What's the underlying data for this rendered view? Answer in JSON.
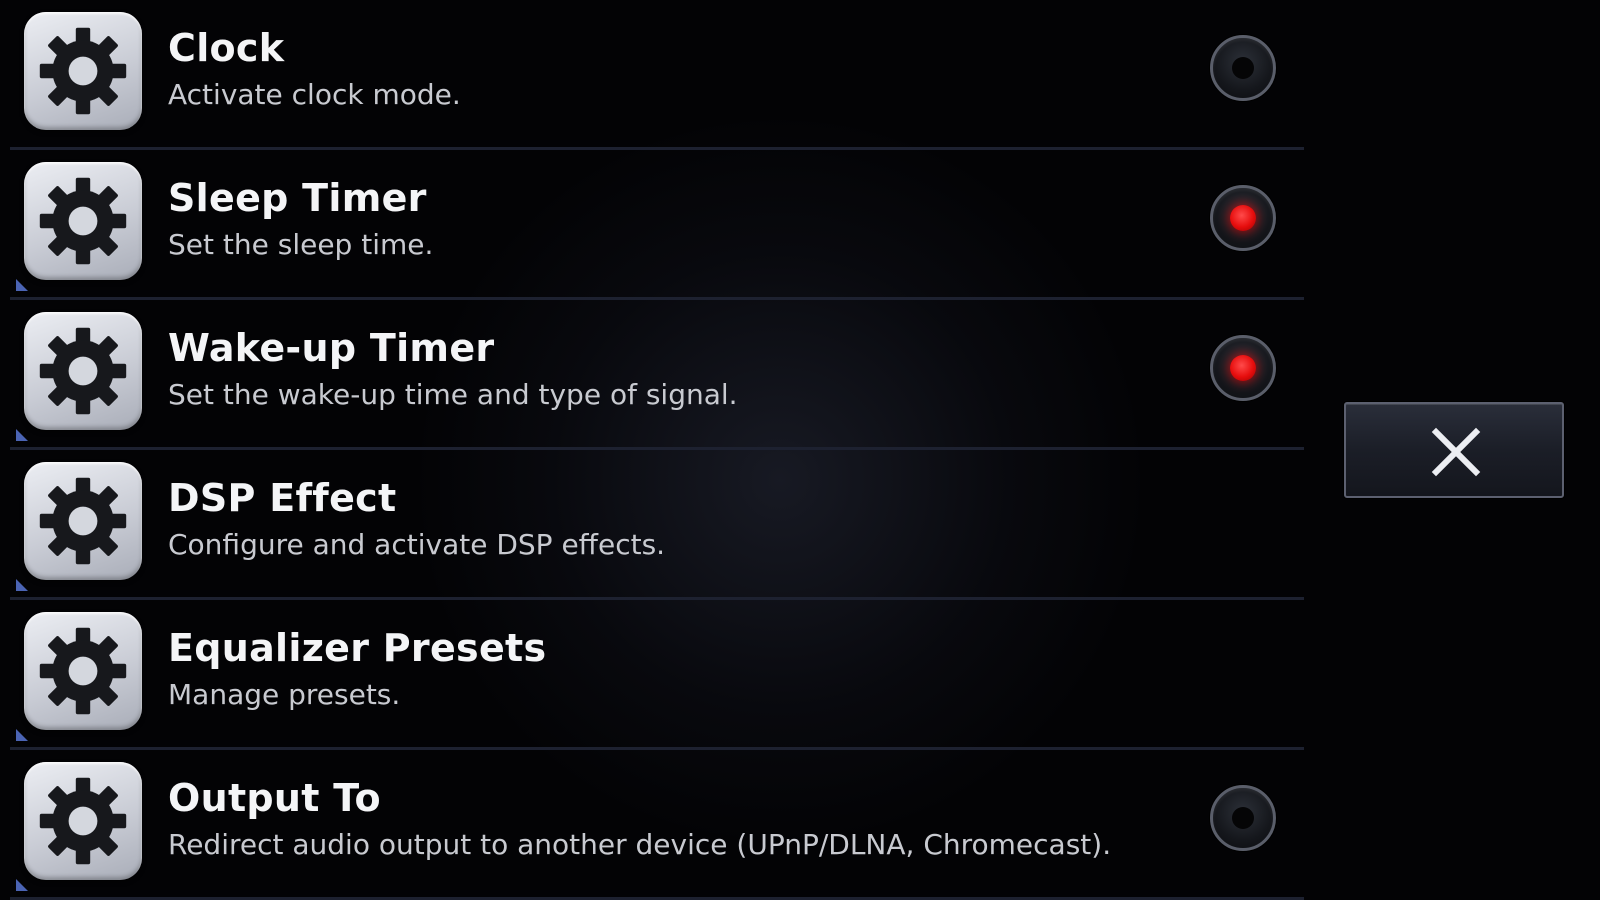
{
  "menu": {
    "items": [
      {
        "title": "Clock",
        "description": "Activate clock mode.",
        "icon": "gear-icon",
        "has_toggle": true,
        "toggle_on": false,
        "has_corner_mark": false
      },
      {
        "title": "Sleep Timer",
        "description": "Set the sleep time.",
        "icon": "gear-icon",
        "has_toggle": true,
        "toggle_on": true,
        "has_corner_mark": true
      },
      {
        "title": "Wake-up Timer",
        "description": "Set the wake-up time and type of signal.",
        "icon": "gear-icon",
        "has_toggle": true,
        "toggle_on": true,
        "has_corner_mark": true
      },
      {
        "title": "DSP Effect",
        "description": "Configure and activate DSP effects.",
        "icon": "gear-icon",
        "has_toggle": false,
        "toggle_on": false,
        "has_corner_mark": true
      },
      {
        "title": "Equalizer Presets",
        "description": "Manage presets.",
        "icon": "gear-icon",
        "has_toggle": false,
        "toggle_on": false,
        "has_corner_mark": true
      },
      {
        "title": "Output To",
        "description": "Redirect audio output to another device (UPnP/DLNA, Chromecast).",
        "icon": "gear-icon",
        "has_toggle": true,
        "toggle_on": false,
        "has_corner_mark": true
      }
    ]
  },
  "close_button": {
    "icon": "close-icon"
  },
  "colors": {
    "background": "#030305",
    "divider": "#1d2130",
    "toggle_active": "#e60d0d",
    "corner_mark": "#4b64b4"
  }
}
